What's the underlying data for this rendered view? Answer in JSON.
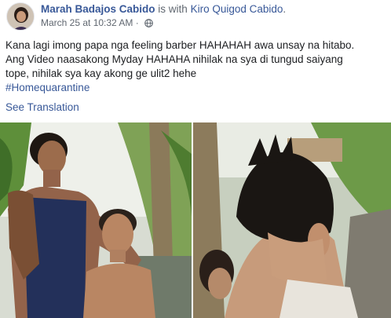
{
  "post": {
    "author": "Marah Badajos Cabido",
    "with_prefix": "is with",
    "tagged_user": "Kiro Quigod Cabido",
    "with_suffix": ".",
    "timestamp": "March 25 at 10:32 AM",
    "separator": "·",
    "privacy_icon": "globe-icon",
    "text_lines": [
      "Kana lagi imong papa nga feeling barber HAHAHAH awa unsay na hitabo.",
      "Ang Video naasakong Myday HAHAHA nihilak na sya di tungud saiyang",
      "tope, nihilak sya kay akong ge ulit2 hehe"
    ],
    "hashtag": "#Homequarantine",
    "see_translation": "See Translation"
  },
  "photos": [
    {
      "description_icon": "photo-man-and-boy"
    },
    {
      "description_icon": "photo-haircut-back-of-head"
    }
  ],
  "colors": {
    "link": "#385898",
    "secondary": "#606770",
    "text": "#1c1e21"
  }
}
